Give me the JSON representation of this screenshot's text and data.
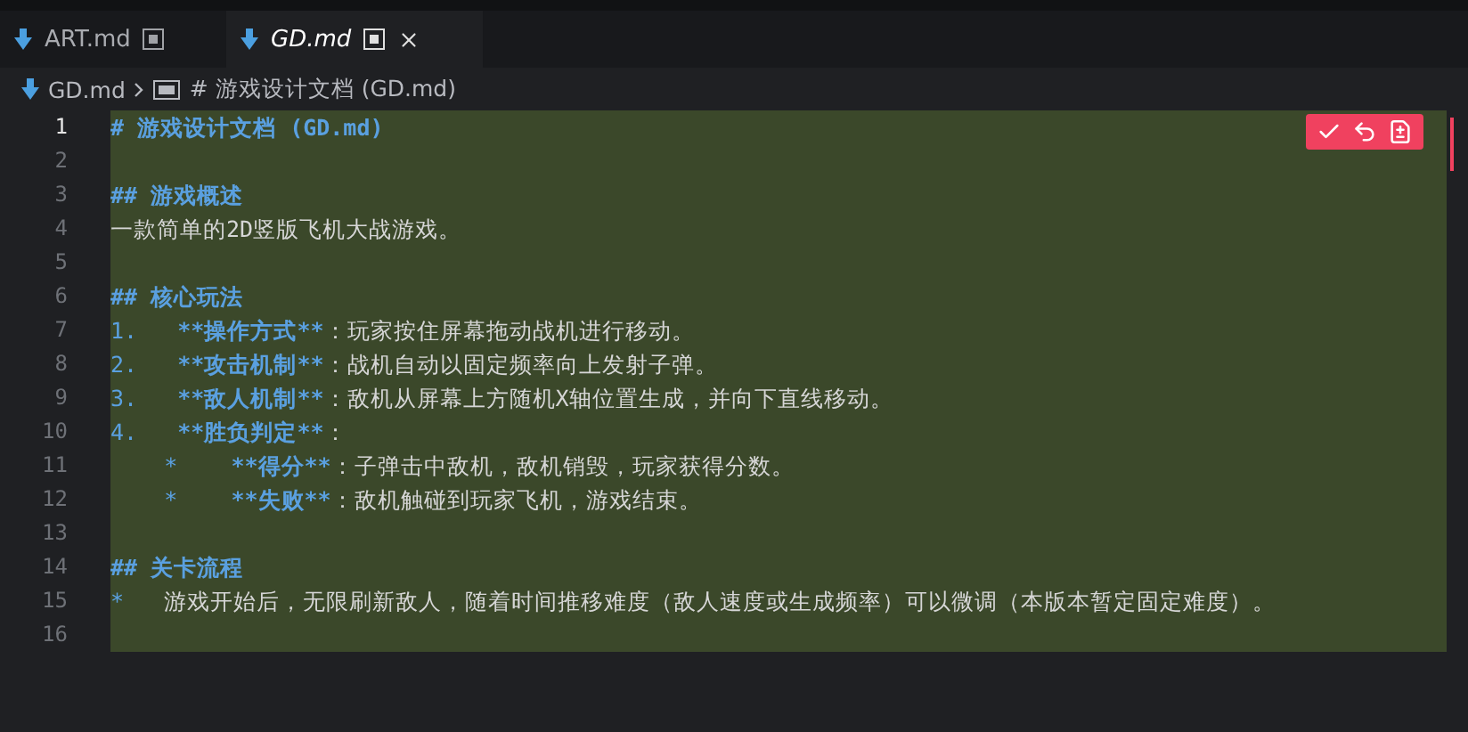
{
  "tabs": [
    {
      "label": "ART.md",
      "selected": false
    },
    {
      "label": "GD.md",
      "selected": true
    }
  ],
  "breadcrumb": {
    "file": "GD.md",
    "symbol": "# 游戏设计文档 (GD.md)"
  },
  "inline_actions": [
    {
      "kind": "accept"
    },
    {
      "kind": "undo"
    },
    {
      "kind": "diff"
    }
  ],
  "lines": [
    {
      "number": "1",
      "active": true,
      "highlighted": true,
      "segments": [
        {
          "kind": "heading",
          "text": "# 游戏设计文档 (GD.md)"
        }
      ]
    },
    {
      "number": "2",
      "active": false,
      "highlighted": true
    },
    {
      "number": "3",
      "active": false,
      "highlighted": true,
      "segments": [
        {
          "kind": "heading",
          "text": "## 游戏概述"
        }
      ]
    },
    {
      "number": "4",
      "active": false,
      "highlighted": true,
      "segments": [
        {
          "kind": "text",
          "text": "一款简单的2D竖版飞机大战游戏。"
        }
      ]
    },
    {
      "number": "5",
      "active": false,
      "highlighted": true
    },
    {
      "number": "6",
      "active": false,
      "highlighted": true,
      "segments": [
        {
          "kind": "heading",
          "text": "## 核心玩法"
        }
      ]
    },
    {
      "number": "7",
      "active": false,
      "highlighted": true,
      "segments": [
        {
          "kind": "marker",
          "text": "1.   "
        },
        {
          "kind": "strong",
          "text": "**操作方式**"
        },
        {
          "kind": "text",
          "text": "：玩家按住屏幕拖动战机进行移动。"
        }
      ]
    },
    {
      "number": "8",
      "active": false,
      "highlighted": true,
      "segments": [
        {
          "kind": "marker",
          "text": "2.   "
        },
        {
          "kind": "strong",
          "text": "**攻击机制**"
        },
        {
          "kind": "text",
          "text": "：战机自动以固定频率向上发射子弹。"
        }
      ]
    },
    {
      "number": "9",
      "active": false,
      "highlighted": true,
      "segments": [
        {
          "kind": "marker",
          "text": "3.   "
        },
        {
          "kind": "strong",
          "text": "**敌人机制**"
        },
        {
          "kind": "text",
          "text": "：敌机从屏幕上方随机X轴位置生成，并向下直线移动。"
        }
      ]
    },
    {
      "number": "10",
      "active": false,
      "highlighted": true,
      "segments": [
        {
          "kind": "marker",
          "text": "4.   "
        },
        {
          "kind": "strong",
          "text": "**胜负判定**"
        },
        {
          "kind": "text",
          "text": "："
        }
      ]
    },
    {
      "number": "11",
      "active": false,
      "highlighted": true,
      "segments": [
        {
          "kind": "marker",
          "text": "    *    "
        },
        {
          "kind": "strong",
          "text": "**得分**"
        },
        {
          "kind": "text",
          "text": "：子弹击中敌机，敌机销毁，玩家获得分数。"
        }
      ]
    },
    {
      "number": "12",
      "active": false,
      "highlighted": true,
      "segments": [
        {
          "kind": "marker",
          "text": "    *    "
        },
        {
          "kind": "strong",
          "text": "**失败**"
        },
        {
          "kind": "text",
          "text": "：敌机触碰到玩家飞机，游戏结束。"
        }
      ]
    },
    {
      "number": "13",
      "active": false,
      "highlighted": true
    },
    {
      "number": "14",
      "active": false,
      "highlighted": true,
      "segments": [
        {
          "kind": "heading",
          "text": "## 关卡流程"
        }
      ]
    },
    {
      "number": "15",
      "active": false,
      "highlighted": true,
      "segments": [
        {
          "kind": "marker",
          "text": "*   "
        },
        {
          "kind": "text",
          "text": "游戏开始后，无限刷新敌人，随着时间推移难度（敌人速度或生成频率）可以微调（本版本暂定固定难度）。"
        }
      ]
    },
    {
      "number": "16",
      "active": false,
      "highlighted": true
    }
  ]
}
